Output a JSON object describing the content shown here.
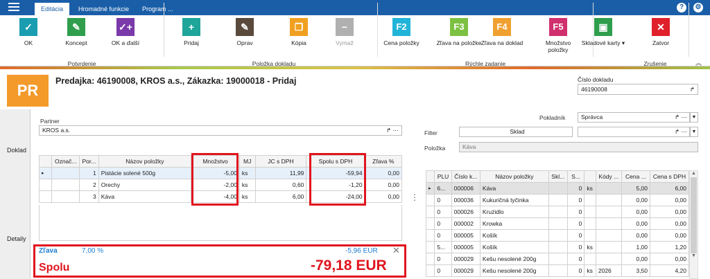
{
  "app": {
    "menu_tabs": [
      "Editácia",
      "Hromadné funkcie",
      "Program ..."
    ]
  },
  "ribbon": {
    "buttons": [
      {
        "label": "OK",
        "icon": "✓",
        "color": "#1a9db0"
      },
      {
        "label": "Koncept",
        "icon": "✎",
        "color": "#2f9e4d"
      },
      {
        "label": "OK a ďalší",
        "icon": "✓+",
        "color": "#7a3aaa"
      },
      {
        "label": "Pridaj",
        "icon": "+",
        "color": "#1fa59a"
      },
      {
        "label": "Oprav",
        "icon": "✎",
        "color": "#5a4a3c"
      },
      {
        "label": "Kópia",
        "icon": "❐",
        "color": "#f0a020"
      },
      {
        "label": "Vymaž",
        "icon": "−",
        "color": "#b0b0b0"
      },
      {
        "label": "Cena položky",
        "icon": "F2",
        "color": "#22b4d8"
      },
      {
        "label": "Zľava na položke",
        "icon": "F3",
        "color": "#7dc142"
      },
      {
        "label": "Zľava na doklad",
        "icon": "F4",
        "color": "#f0a030"
      },
      {
        "label": "Množstvo položky",
        "icon": "F5",
        "color": "#d0306e"
      },
      {
        "label": "Skladové karty ▾",
        "icon": "▣",
        "color": "#2f9e4d"
      },
      {
        "label": "Zatvor",
        "icon": "✕",
        "color": "#e0202a"
      }
    ],
    "groups": [
      "Potvrdenie",
      "Položka dokladu",
      "Rýchle zadanie",
      "Zrušenie"
    ]
  },
  "header": {
    "badge": "PR",
    "title": "Predajka: 46190008, KROS a.s., Zákazka: 19000018 - Pridaj",
    "doc_label": "Číslo dokladu",
    "doc_value": "46190008"
  },
  "sidebar": {
    "tabs": [
      "Doklad",
      "Detaily"
    ]
  },
  "partner": {
    "label": "Partner",
    "value": "KROS a.s."
  },
  "items_table": {
    "headers": [
      "Označ...",
      "Por...",
      "Názov položky",
      "Množstvo",
      "MJ",
      "JC s DPH",
      "Spolu s DPH",
      "Zľava %"
    ],
    "rows": [
      [
        "",
        "1",
        "Pistácie solené 500g",
        "-5,00",
        "ks",
        "11,99",
        "-59,94",
        "0,00"
      ],
      [
        "",
        "2",
        "Orechy",
        "-2,00",
        "ks",
        "0,60",
        "-1,20",
        "0,00"
      ],
      [
        "",
        "3",
        "Káva",
        "-4,00",
        "ks",
        "6,00",
        "-24,00",
        "0,00"
      ]
    ]
  },
  "totals": {
    "discount_label": "Zľava",
    "discount_pct": "7,00 %",
    "discount_value": "-5,96 EUR",
    "total_label": "Spolu",
    "total_value": "-79,18 EUR"
  },
  "right": {
    "cashier_label": "Pokladník",
    "cashier_value": "Správca",
    "filter_label": "Filter",
    "filter_button": "Sklad",
    "item_label": "Položka",
    "item_value": "Káva",
    "headers": [
      "PLU",
      "Číslo k...",
      "Názov položky",
      "Skl...",
      "S...",
      "",
      "Kódy ...",
      "Cena ...",
      "Cena s DPH"
    ],
    "rows": [
      [
        "6...",
        "000006",
        "Káva",
        "",
        "0",
        "ks",
        "",
        "5,00",
        "6,00"
      ],
      [
        "0",
        "000036",
        "Kukuričná tyčinka",
        "",
        "0",
        "",
        "",
        "0,00",
        "0,00"
      ],
      [
        "0",
        "000026",
        "Krużidlo",
        "",
        "0",
        "",
        "",
        "0,00",
        "0,00"
      ],
      [
        "0",
        "000002",
        "Krowka",
        "",
        "0",
        "",
        "",
        "0,00",
        "0,00"
      ],
      [
        "0",
        "000005",
        "Košík",
        "",
        "0",
        "",
        "",
        "0,00",
        "0,00"
      ],
      [
        "5...",
        "000005",
        "Košík",
        "",
        "0",
        "ks",
        "",
        "1,00",
        "1,20"
      ],
      [
        "0",
        "000029",
        "Kešu nesolené 200g",
        "",
        "0",
        "",
        "",
        "0,00",
        "0,00"
      ],
      [
        "0",
        "000029",
        "Kešu nesolené 200g",
        "",
        "0",
        "ks",
        "2026",
        "3,50",
        "4,20"
      ]
    ]
  }
}
